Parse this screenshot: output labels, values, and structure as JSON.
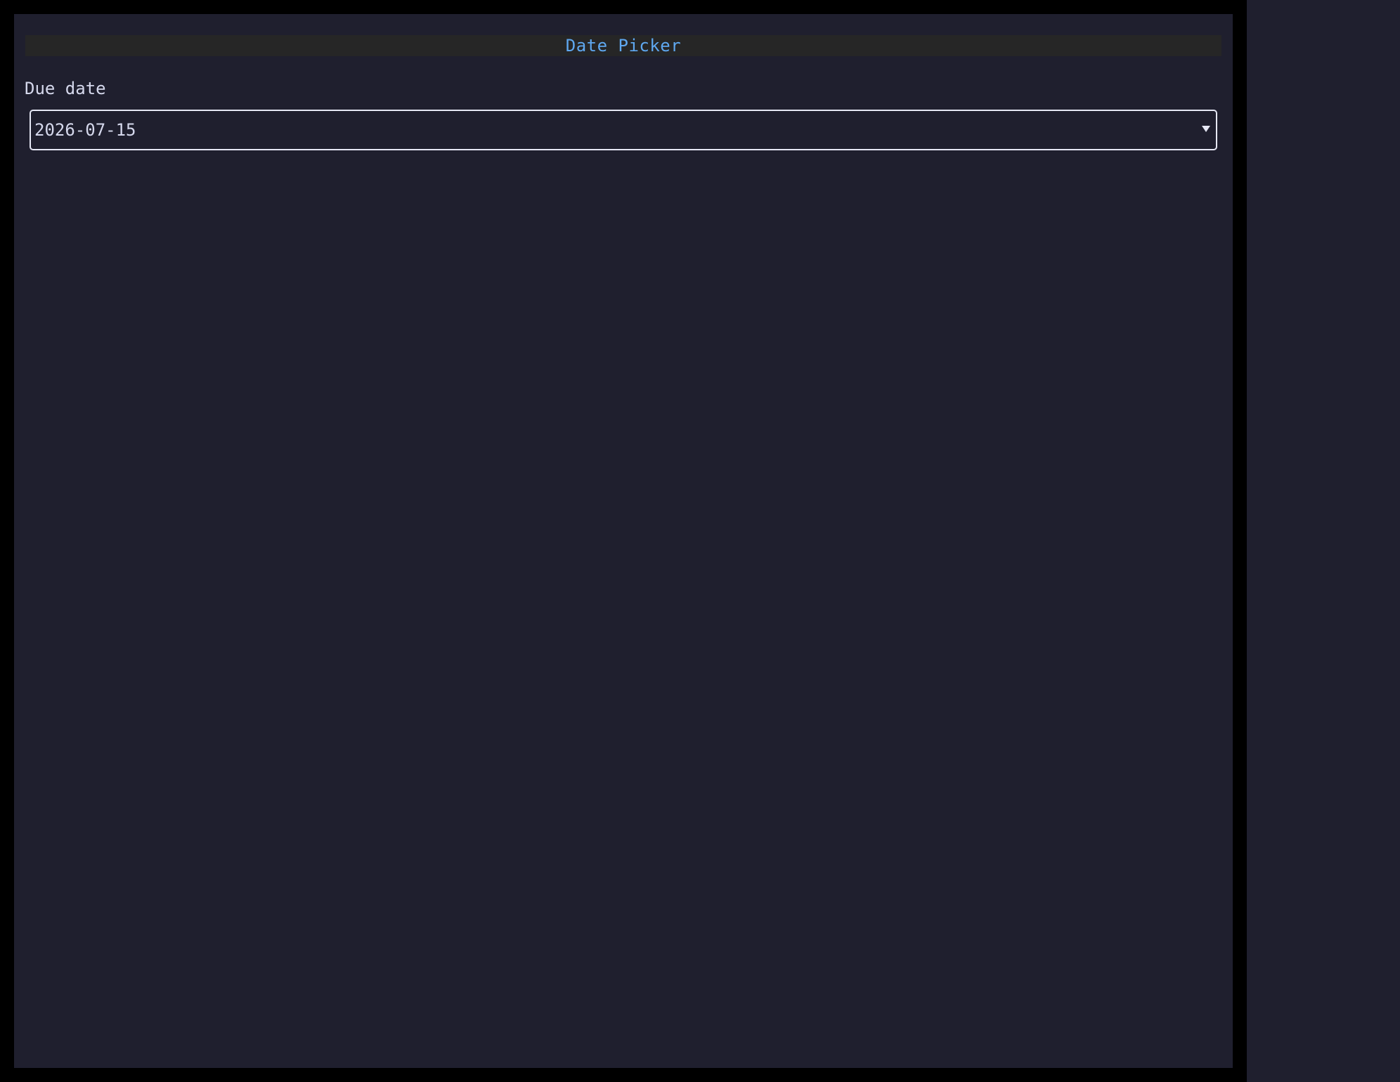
{
  "app": {
    "title": "Date Picker"
  },
  "form": {
    "due_date_label": "Due date",
    "due_date_value": "2026-07-15"
  },
  "icons": {
    "dropdown": "chevron-down-icon"
  },
  "colors": {
    "background": "#1f1f2e",
    "title_bar": "#262626",
    "title_text": "#5fa8f0",
    "text": "#d5d8ec",
    "border": "#e6e8f5"
  }
}
